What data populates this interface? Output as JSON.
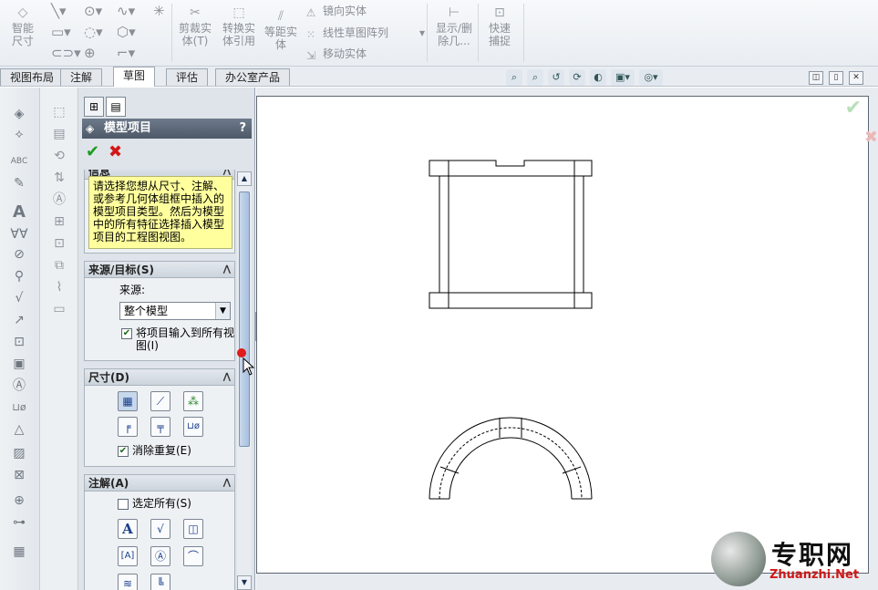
{
  "ribbon": {
    "smart_dim": "智能尺寸",
    "trim": "剪裁实体(T)",
    "convert": "转换实体引用",
    "offset": "等距实体",
    "mirror": "镜向实体",
    "linear_pattern": "线性草图阵列",
    "move": "移动实体",
    "show_hide": "显示/删除几...",
    "quick_snap": "快速捕捉"
  },
  "tabs": [
    "视图布局",
    "注解",
    "草图",
    "评估",
    "办公室产品"
  ],
  "active_tab": "草图",
  "pm": {
    "title": "模型项目",
    "help": "?",
    "message_section": "信息",
    "message": "请选择您想从尺寸、注解、或参考几何体组框中插入的模型项目类型。然后为模型中的所有特征选择插入模型项目的工程图视图。",
    "source_section": "来源/目标(S)",
    "source_label": "来源:",
    "source_value": "整个模型",
    "import_all_views": "将项目输入到所有视图(I)",
    "import_all_views_checked": true,
    "dimensions_section": "尺寸(D)",
    "eliminate_duplicates": "消除重复(E)",
    "eliminate_duplicates_checked": true,
    "annotations_section": "注解(A)",
    "select_all": "选定所有(S)",
    "select_all_checked": false
  },
  "watermark": {
    "cn": "专职网",
    "en": "Zhuanzhi.Net"
  }
}
